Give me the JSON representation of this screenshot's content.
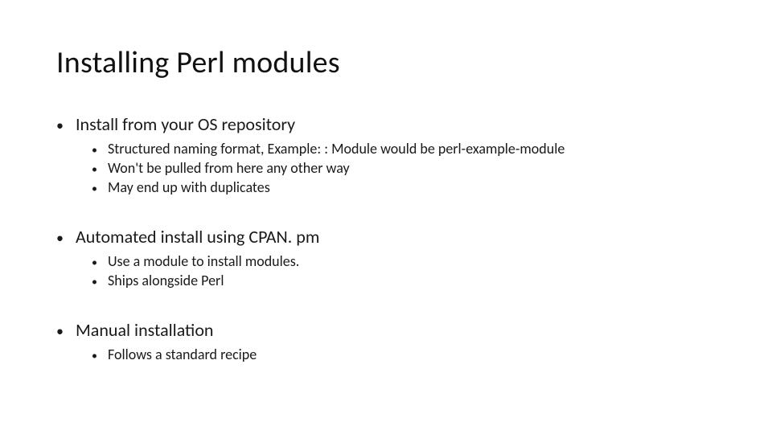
{
  "slide": {
    "title": "Installing Perl modules",
    "sections": [
      {
        "heading": "Install from your OS repository",
        "items": [
          "Structured naming format, Example: : Module would be perl-example-module",
          "Won't be pulled from here any other way",
          "May end up with duplicates"
        ]
      },
      {
        "heading": "Automated install using CPAN. pm",
        "items": [
          "Use a module to install modules.",
          "Ships alongside Perl"
        ]
      },
      {
        "heading": "Manual installation",
        "items": [
          "Follows a standard recipe"
        ]
      }
    ]
  }
}
